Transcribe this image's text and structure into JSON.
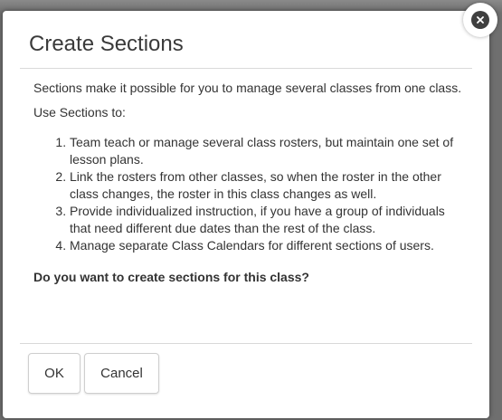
{
  "dialog": {
    "title": "Create Sections",
    "intro": "Sections make it possible for you to manage several classes from one class.",
    "use_label": "Use Sections to:",
    "uses": [
      "Team teach or manage several class rosters, but maintain one set of lesson plans.",
      "Link the rosters from other classes, so when the roster in the other class changes, the roster in this class changes as well.",
      "Provide individualized instruction, if you have a group of individuals that need different due dates than the rest of the class.",
      "Manage separate Class Calendars for different sections of users."
    ],
    "question": "Do you want to create sections for this class?",
    "ok_label": "OK",
    "cancel_label": "Cancel"
  },
  "icons": {
    "close": "close-icon"
  },
  "colors": {
    "backdrop": "#6f6f6f",
    "dialog_bg": "#ffffff",
    "text": "#333333",
    "close_icon": "#3f3f3f"
  }
}
